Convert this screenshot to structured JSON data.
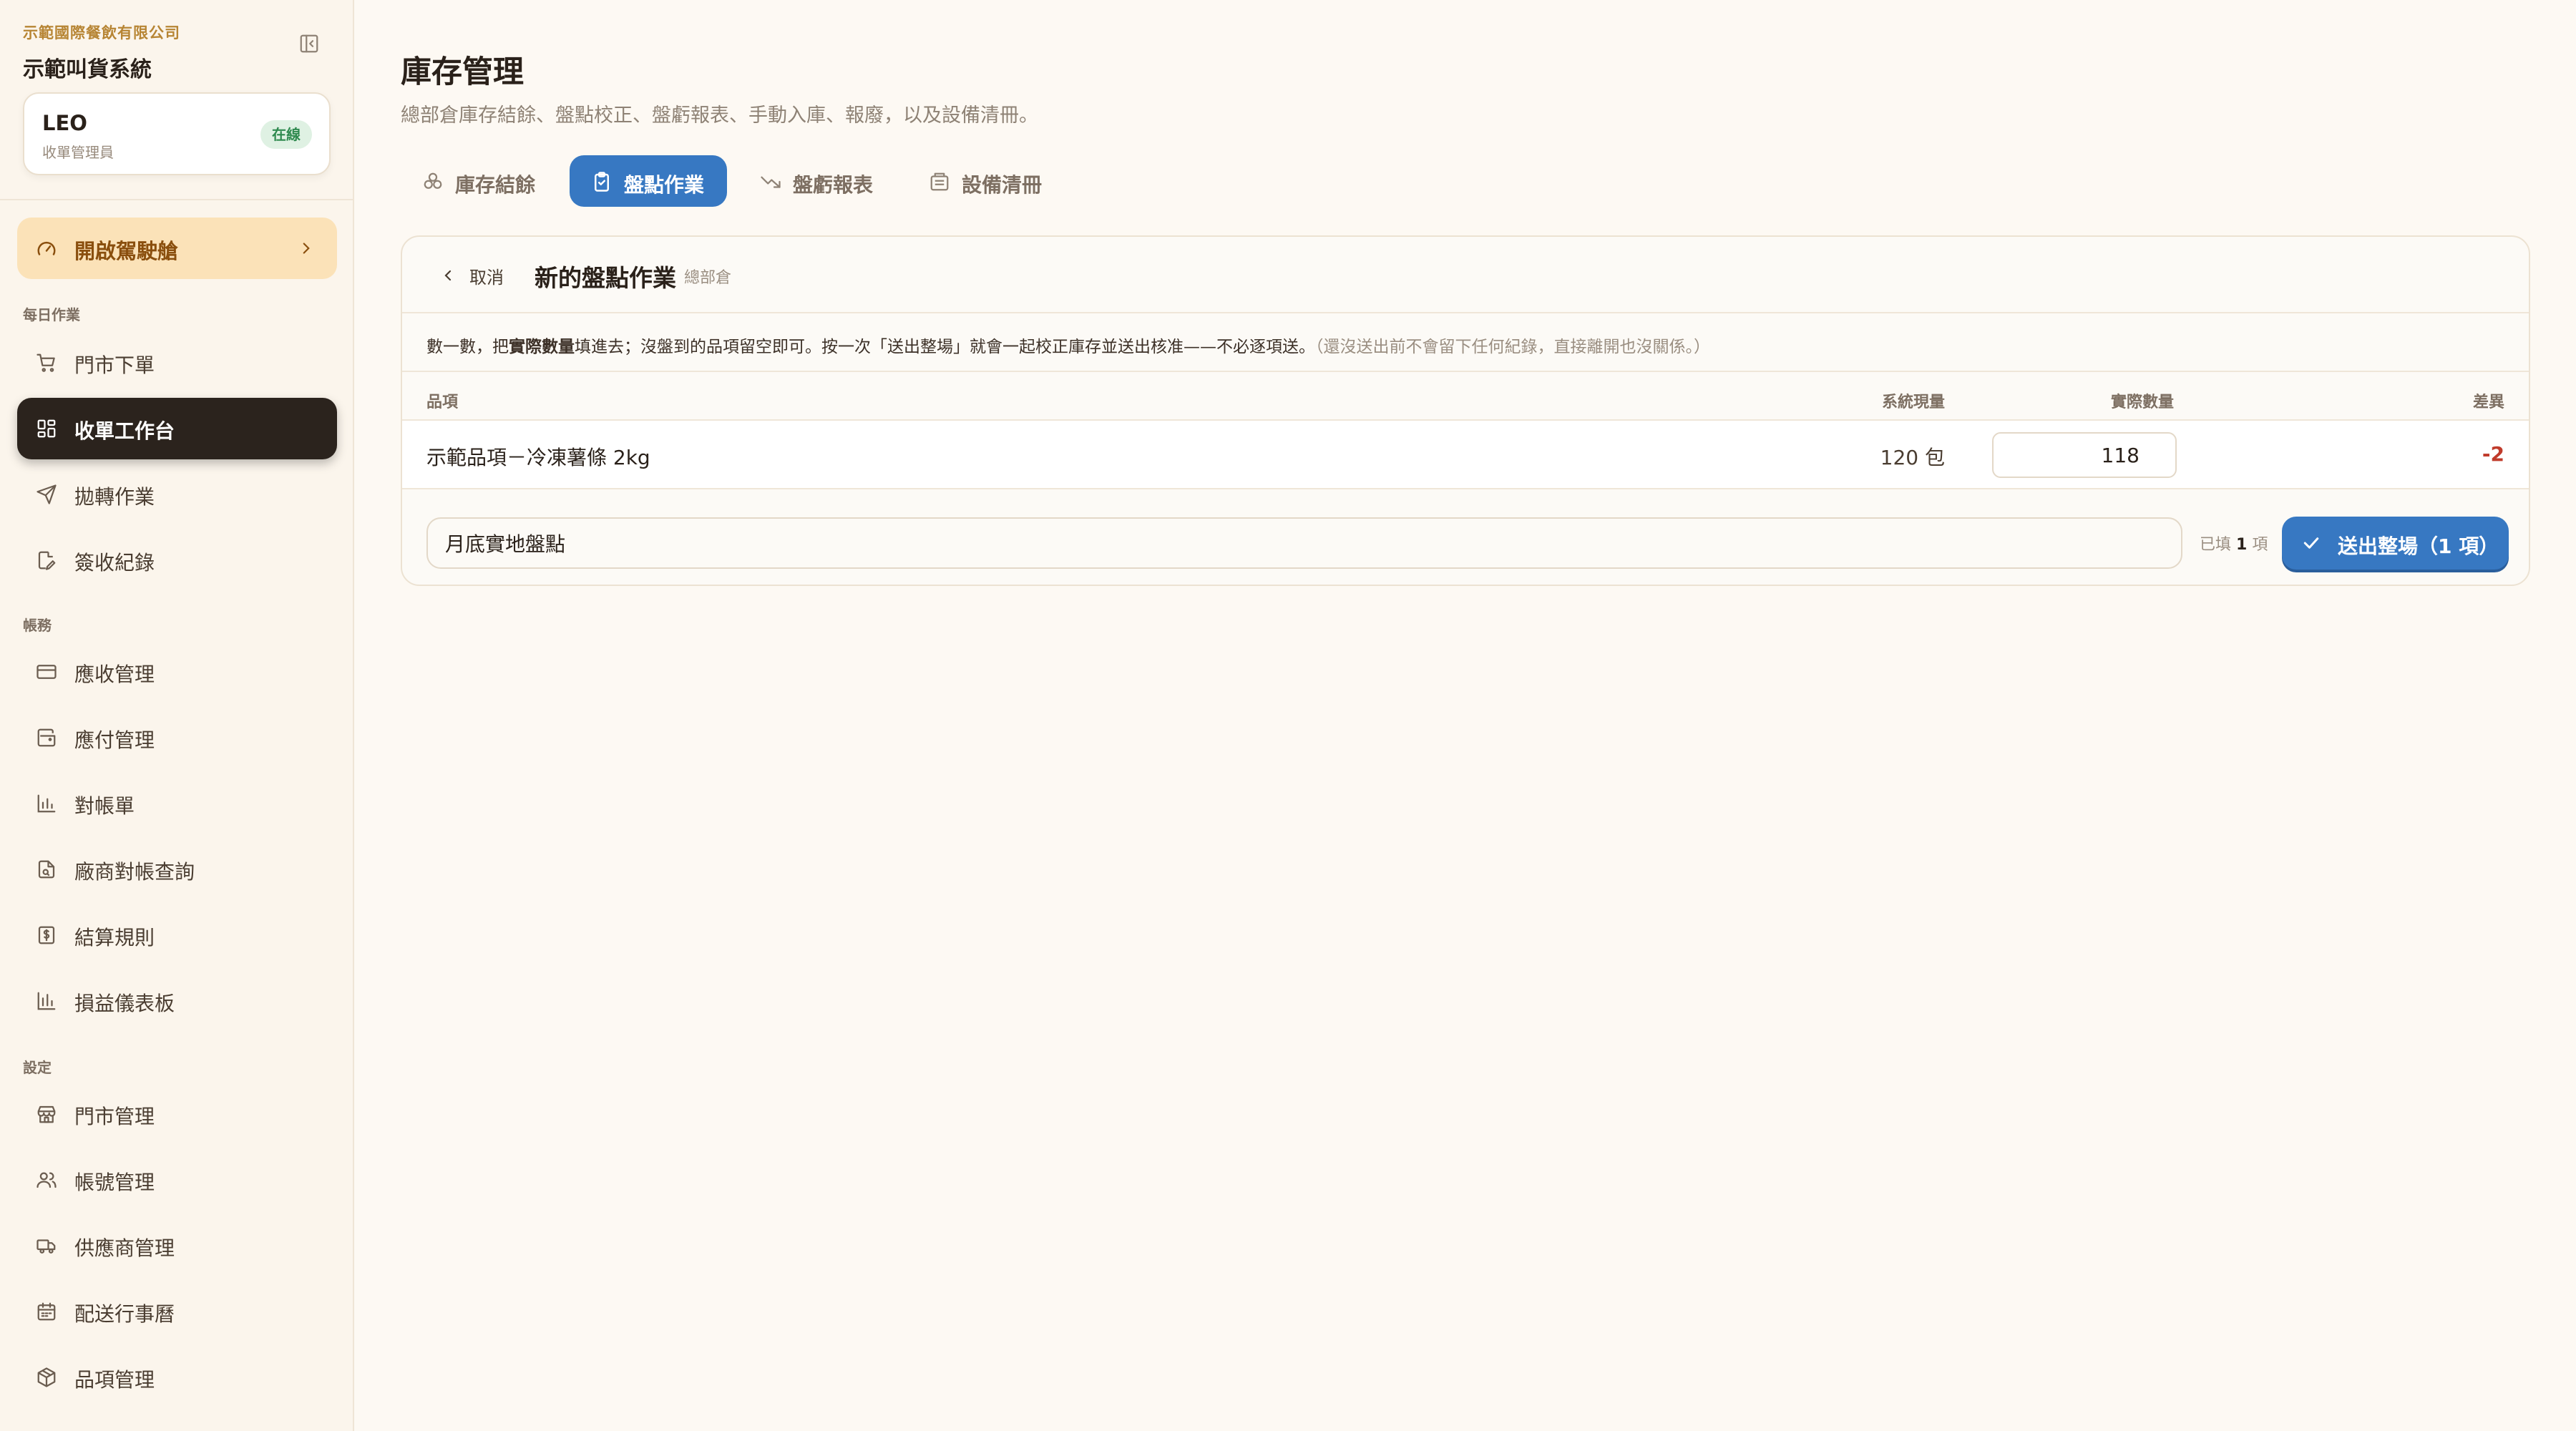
{
  "sidebar": {
    "company": "示範國際餐飲有限公司",
    "system_name": "示範叫貨系統",
    "user": {
      "name": "LEO",
      "role": "收單管理員",
      "status": "在線"
    },
    "cockpit": "開啟駕駛艙",
    "sections": {
      "daily": "每日作業",
      "accounts": "帳務",
      "settings": "設定"
    },
    "items": {
      "store_order": "門市下單",
      "receive_workbench": "收單工作台",
      "transfer": "拋轉作業",
      "sign_records": "簽收紀錄",
      "receivables": "應收管理",
      "payables": "應付管理",
      "statements": "對帳單",
      "vendor_recon": "廠商對帳查詢",
      "settle_rules": "結算規則",
      "pl_dashboard": "損益儀表板",
      "store_mgmt": "門市管理",
      "account_mgmt": "帳號管理",
      "supplier_mgmt": "供應商管理",
      "delivery_calendar": "配送行事曆",
      "item_mgmt": "品項管理"
    }
  },
  "header": {
    "title": "庫存管理",
    "subtitle": "總部倉庫存結餘、盤點校正、盤虧報表、手動入庫、報廢，以及設備清冊。"
  },
  "tabs": [
    {
      "label": "庫存結餘",
      "icon": "boxes-icon",
      "active": false
    },
    {
      "label": "盤點作業",
      "icon": "clipboard-check-icon",
      "active": true
    },
    {
      "label": "盤虧報表",
      "icon": "trending-down-icon",
      "active": false
    },
    {
      "label": "設備清冊",
      "icon": "register-icon",
      "active": false
    }
  ],
  "panel": {
    "cancel": "取消",
    "title": "新的盤點作業",
    "warehouse": "總部倉",
    "instruction_a": "數一數，把",
    "instruction_b": "實際數量",
    "instruction_c": "填進去；沒盤到的品項留空即可。按一次「送出整場」就會一起校正庫存並送出核准——不必逐項送。",
    "instruction_muted": "（還沒送出前不會留下任何紀錄，直接離開也沒關係。）",
    "columns": {
      "item": "品項",
      "system_qty": "系統現量",
      "actual_qty": "實際數量",
      "diff": "差異"
    },
    "rows": [
      {
        "name": "示範品項－冷凍薯條 2kg",
        "system_qty": "120 包",
        "actual_qty": "118",
        "diff": "-2"
      }
    ],
    "note_value": "月底實地盤點",
    "filled_prefix": "已填",
    "filled_count": "1",
    "filled_suffix": "項",
    "submit_label": "送出整場（1 項）"
  },
  "colors": {
    "accent_blue": "#3778c2",
    "dark_nav": "#2b231d",
    "cockpit_bg": "#fbe2b8",
    "diff_red": "#c03b2b",
    "online_green": "#2f8a4f"
  }
}
